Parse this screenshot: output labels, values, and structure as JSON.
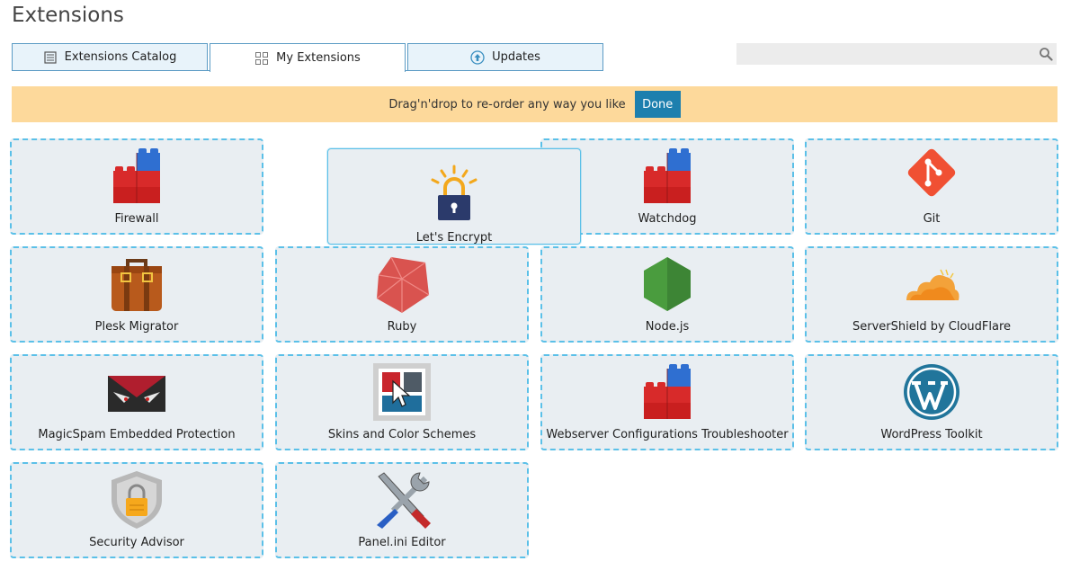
{
  "page": {
    "title": "Extensions"
  },
  "tabs": [
    {
      "label": "Extensions Catalog",
      "icon": "catalog-icon",
      "active": false
    },
    {
      "label": "My Extensions",
      "icon": "grid-icon",
      "active": true
    },
    {
      "label": "Updates",
      "icon": "upload-icon",
      "active": false
    }
  ],
  "search": {
    "value": "",
    "placeholder": ""
  },
  "banner": {
    "text": "Drag'n'drop to re-order any way you like",
    "done_label": "Done"
  },
  "extensions": [
    {
      "name": "Firewall",
      "icon": "lego-bricks-icon"
    },
    {
      "name": "Let's Encrypt",
      "icon": "lock-icon"
    },
    {
      "name": "Watchdog",
      "icon": "lego-bricks-icon"
    },
    {
      "name": "Git",
      "icon": "git-icon"
    },
    {
      "name": "Plesk Migrator",
      "icon": "suitcase-icon"
    },
    {
      "name": "Ruby",
      "icon": "ruby-icon"
    },
    {
      "name": "Node.js",
      "icon": "nodejs-icon"
    },
    {
      "name": "ServerShield by CloudFlare",
      "icon": "cloudflare-icon"
    },
    {
      "name": "MagicSpam Embedded Protection",
      "icon": "magicspam-icon"
    },
    {
      "name": "Skins and Color Schemes",
      "icon": "skins-icon"
    },
    {
      "name": "Webserver Configurations Troubleshooter",
      "icon": "lego-bricks-icon"
    },
    {
      "name": "WordPress Toolkit",
      "icon": "wordpress-icon"
    },
    {
      "name": "Security Advisor",
      "icon": "shield-lock-icon"
    },
    {
      "name": "Panel.ini Editor",
      "icon": "tools-icon"
    }
  ],
  "colors": {
    "accent": "#1d7fae",
    "banner": "#fdd99b",
    "card_border": "#5bc0e8",
    "tab_border": "#5b9bc4"
  }
}
